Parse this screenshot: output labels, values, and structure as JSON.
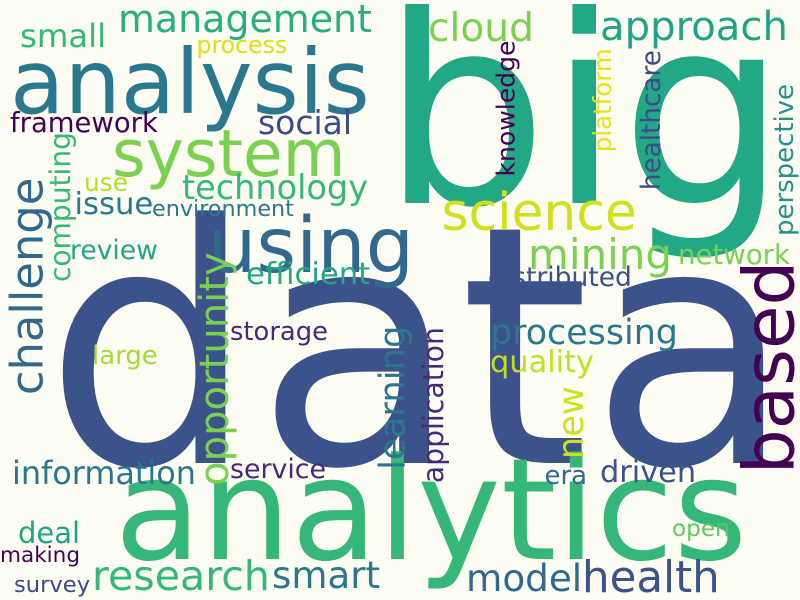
{
  "words": [
    {
      "text": "data",
      "color": "#3b528b",
      "orientation": "horizontal"
    },
    {
      "text": "big",
      "color": "#22a884",
      "orientation": "horizontal"
    },
    {
      "text": "analytics",
      "color": "#35b779",
      "orientation": "horizontal"
    },
    {
      "text": "analysis",
      "color": "#2a788e",
      "orientation": "horizontal"
    },
    {
      "text": "using",
      "color": "#31688e",
      "orientation": "horizontal"
    },
    {
      "text": "system",
      "color": "#7ad151",
      "orientation": "horizontal"
    },
    {
      "text": "based",
      "color": "#440154",
      "orientation": "vertical"
    },
    {
      "text": "management",
      "color": "#29af7f",
      "orientation": "horizontal"
    },
    {
      "text": "approach",
      "color": "#20a486",
      "orientation": "horizontal"
    },
    {
      "text": "science",
      "color": "#d0e11c",
      "orientation": "horizontal"
    },
    {
      "text": "challenge",
      "color": "#31688e",
      "orientation": "vertical"
    },
    {
      "text": "research",
      "color": "#35b779",
      "orientation": "horizontal"
    },
    {
      "text": "health",
      "color": "#3b528b",
      "orientation": "horizontal"
    },
    {
      "text": "model",
      "color": "#31688e",
      "orientation": "horizontal"
    },
    {
      "text": "smart",
      "color": "#2a788e",
      "orientation": "horizontal"
    },
    {
      "text": "mining",
      "color": "#7ad151",
      "orientation": "horizontal"
    },
    {
      "text": "processing",
      "color": "#2a788e",
      "orientation": "horizontal"
    },
    {
      "text": "opportunity",
      "color": "#7ad151",
      "orientation": "vertical"
    },
    {
      "text": "information",
      "color": "#2a788e",
      "orientation": "horizontal"
    },
    {
      "text": "technology",
      "color": "#35b779",
      "orientation": "horizontal"
    },
    {
      "text": "cloud",
      "color": "#7ad151",
      "orientation": "horizontal"
    },
    {
      "text": "new",
      "color": "#d0e11c",
      "orientation": "vertical"
    },
    {
      "text": "learning",
      "color": "#2a788e",
      "orientation": "vertical"
    },
    {
      "text": "framework",
      "color": "#440154",
      "orientation": "horizontal"
    },
    {
      "text": "application",
      "color": "#482878",
      "orientation": "vertical"
    },
    {
      "text": "computing",
      "color": "#35b779",
      "orientation": "vertical"
    },
    {
      "text": "network",
      "color": "#7ad151",
      "orientation": "horizontal"
    },
    {
      "text": "driven",
      "color": "#3b528b",
      "orientation": "horizontal"
    },
    {
      "text": "social",
      "color": "#3e4a89",
      "orientation": "horizontal"
    },
    {
      "text": "efficient",
      "color": "#22a884",
      "orientation": "horizontal"
    },
    {
      "text": "knowledge",
      "color": "#440154",
      "orientation": "vertical"
    },
    {
      "text": "healthcare",
      "color": "#3e4a89",
      "orientation": "vertical"
    },
    {
      "text": "quality",
      "color": "#c2df23",
      "orientation": "horizontal"
    },
    {
      "text": "issue",
      "color": "#2a788e",
      "orientation": "horizontal"
    },
    {
      "text": "review",
      "color": "#22a884",
      "orientation": "horizontal"
    },
    {
      "text": "small",
      "color": "#35b779",
      "orientation": "horizontal"
    },
    {
      "text": "storage",
      "color": "#482878",
      "orientation": "horizontal"
    },
    {
      "text": "service",
      "color": "#482878",
      "orientation": "horizontal"
    },
    {
      "text": "distributed",
      "color": "#3b528b",
      "orientation": "horizontal"
    },
    {
      "text": "environment",
      "color": "#2a788e",
      "orientation": "horizontal"
    },
    {
      "text": "perspective",
      "color": "#21918c",
      "orientation": "vertical"
    },
    {
      "text": "platform",
      "color": "#e5e419",
      "orientation": "vertical"
    },
    {
      "text": "use",
      "color": "#b5de2b",
      "orientation": "horizontal"
    },
    {
      "text": "deal",
      "color": "#20a486",
      "orientation": "horizontal"
    },
    {
      "text": "era",
      "color": "#31688e",
      "orientation": "horizontal"
    },
    {
      "text": "open",
      "color": "#5ec962",
      "orientation": "horizontal"
    },
    {
      "text": "large",
      "color": "#a5db36",
      "orientation": "horizontal"
    },
    {
      "text": "making",
      "color": "#440154",
      "orientation": "horizontal"
    },
    {
      "text": "survey",
      "color": "#3e4a89",
      "orientation": "horizontal"
    },
    {
      "text": "process",
      "color": "#d8e219",
      "orientation": "horizontal"
    }
  ]
}
